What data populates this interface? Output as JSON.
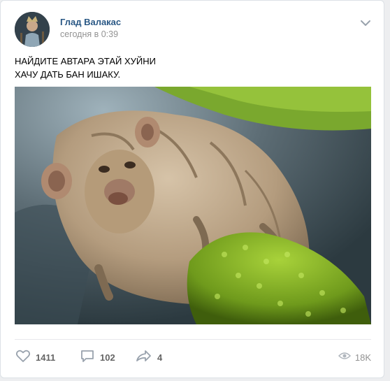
{
  "post": {
    "author": "Глад Валакас",
    "date": "сегодня в 0:39",
    "text_lines": [
      "НАЙДИТЕ АВТАРА ЭТАЙ ХУЙНИ",
      "ХАЧУ ДАТЬ БАН ИШАКУ."
    ]
  },
  "actions": {
    "likes": "1411",
    "comments": "102",
    "shares": "4",
    "views": "18K"
  },
  "icons": {
    "menu": "chevron-down-icon",
    "like": "heart-icon",
    "comment": "comment-icon",
    "share": "share-arrow-icon",
    "views": "eye-icon"
  },
  "colors": {
    "author": "#2a5885",
    "muted": "#939393",
    "action": "#656565"
  }
}
